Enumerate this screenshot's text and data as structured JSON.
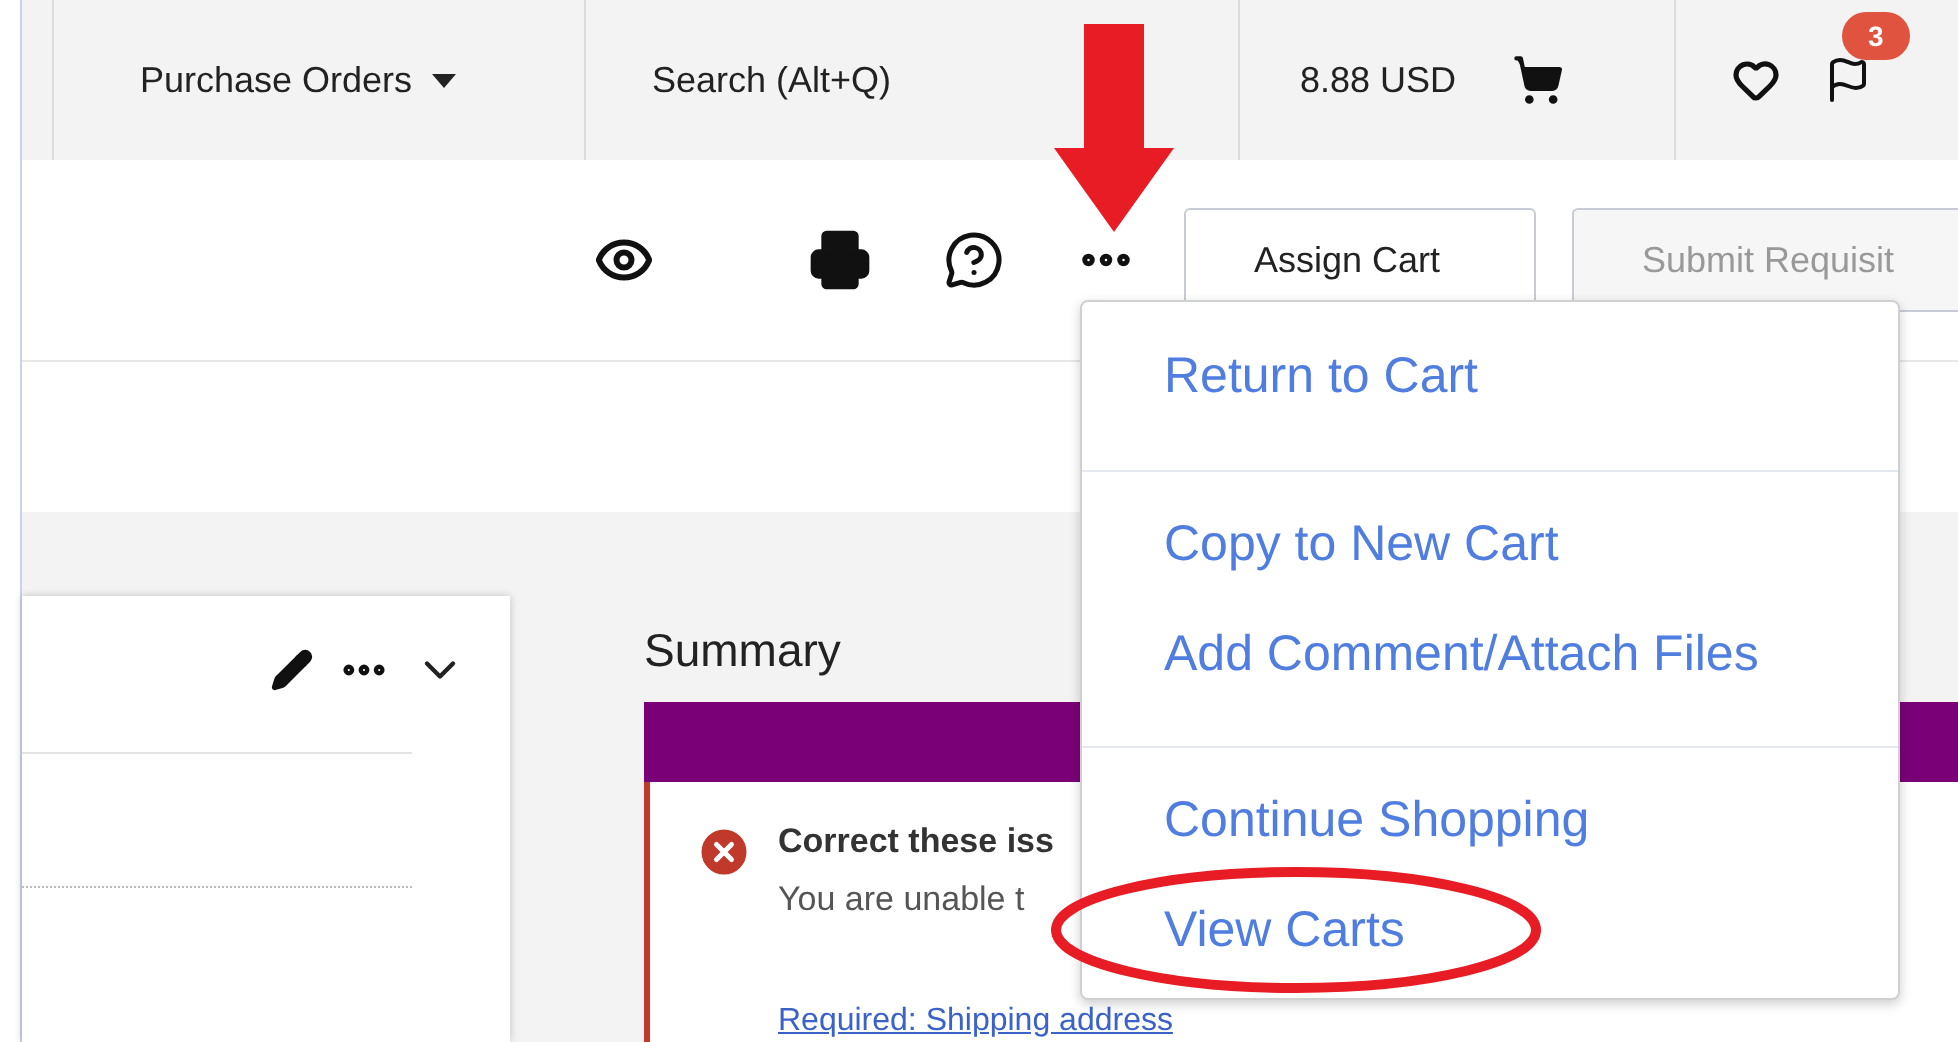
{
  "top_bar": {
    "menu": "Purchase Orders",
    "search": {
      "placeholder": "Search (Alt+Q)"
    },
    "cart_total": "8.88 USD",
    "notification_badge": "3"
  },
  "toolbar": {
    "buttons": [
      {
        "label": "Assign Cart",
        "disabled": false
      },
      {
        "label": "Submit Requisit",
        "disabled": true
      }
    ]
  },
  "menu": {
    "groups": [
      {
        "items": [
          {
            "label": "Return to Cart",
            "annotated": false
          }
        ]
      },
      {
        "items": [
          {
            "label": "Copy to New Cart",
            "annotated": false
          },
          {
            "label": "Add Comment/Attach Files",
            "annotated": false
          }
        ]
      },
      {
        "items": [
          {
            "label": "Continue Shopping",
            "annotated": false
          },
          {
            "label": "View Carts",
            "annotated": true
          }
        ]
      }
    ]
  },
  "summary": {
    "title": "Summary",
    "alert": {
      "title": "Correct these iss",
      "message": "You are unable t",
      "link": "Required: Shipping address"
    }
  }
}
